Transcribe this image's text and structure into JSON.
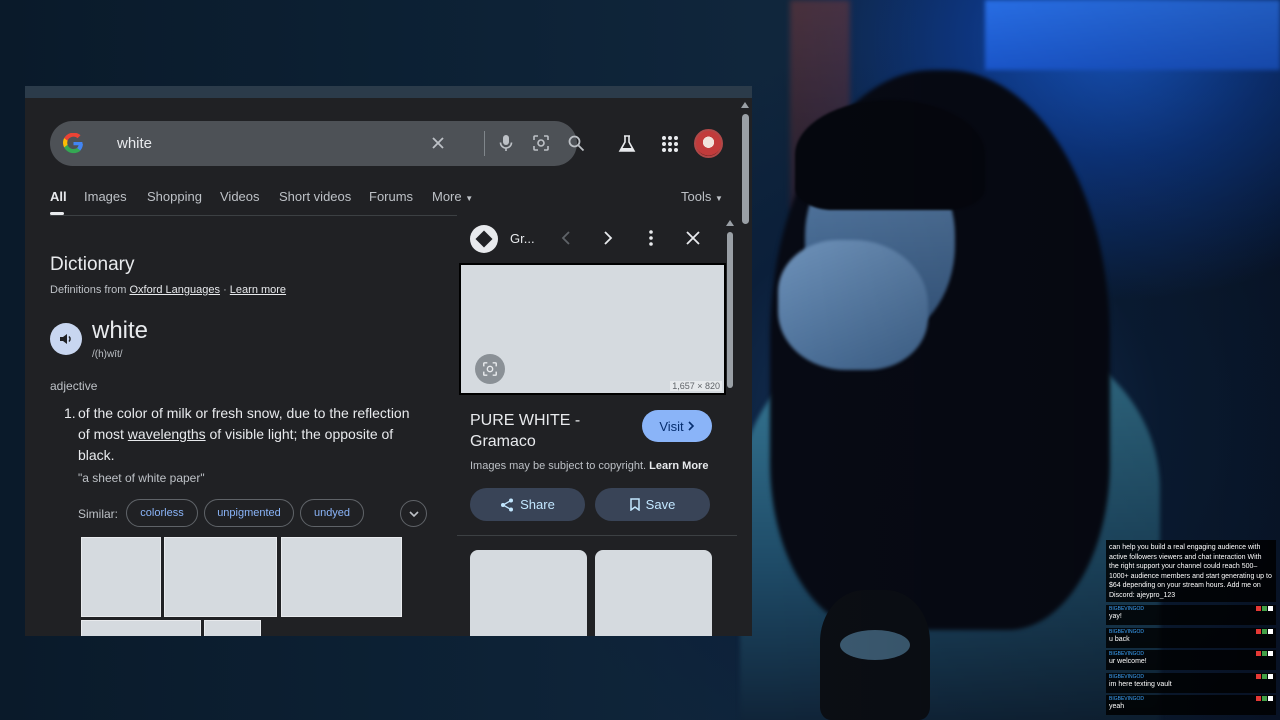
{
  "search": {
    "query": "white"
  },
  "tabs": [
    "All",
    "Images",
    "Shopping",
    "Videos",
    "Short videos",
    "Forums",
    "More",
    "Tools"
  ],
  "dictionary": {
    "title": "Dictionary",
    "source_prefix": "Definitions from",
    "source_name": "Oxford Languages",
    "separator": "·",
    "learn_more": "Learn more",
    "word": "white",
    "pronunciation": "/(h)wīt/",
    "part_of_speech": "adjective",
    "definition_number": "1.",
    "definition_before": "of the color of milk or fresh snow, due to the reflection of most ",
    "definition_link": "wavelengths",
    "definition_after": " of visible light; the opposite of black.",
    "example": "\"a sheet of white paper\"",
    "similar_label": "Similar:",
    "similar": [
      "colorless",
      "unpigmented",
      "undyed"
    ]
  },
  "viewer": {
    "source_name": "Gr...",
    "image_dimensions": "1,657 × 820",
    "title": "PURE WHITE - Gramaco",
    "visit_label": "Visit",
    "copyright_text": "Images may be subject to copyright.",
    "copyright_link": "Learn More",
    "share_label": "Share",
    "save_label": "Save"
  },
  "chat": {
    "spam_message": "can help you build a real engaging audience with active followers viewers and chat interaction With the right support your channel could reach 500–1000+ audience members and start generating up to $64 depending on your stream hours. Add me on Discord: ajeypro_123",
    "messages": [
      {
        "user": "BIGBEVINGOD",
        "text": "yay!"
      },
      {
        "user": "BIGBEVINGOD",
        "text": "u back"
      },
      {
        "user": "BIGBEVINGOD",
        "text": "ur welcome!"
      },
      {
        "user": "BIGBEVINGOD",
        "text": "im here texting vault"
      },
      {
        "user": "BIGBEVINGOD",
        "text": "yeah"
      }
    ]
  },
  "colors": {
    "link_blue": "#8ab4f8",
    "page_bg": "#202124",
    "searchbar_bg": "#4d5156"
  },
  "icons": [
    "google-logo-icon",
    "clear-icon",
    "microphone-icon",
    "lens-icon",
    "search-icon",
    "labs-flask-icon",
    "apps-grid-icon",
    "speaker-icon",
    "chevron-down-icon",
    "chevron-left-icon",
    "chevron-right-icon",
    "more-vert-icon",
    "close-icon",
    "share-icon",
    "bookmark-icon"
  ]
}
